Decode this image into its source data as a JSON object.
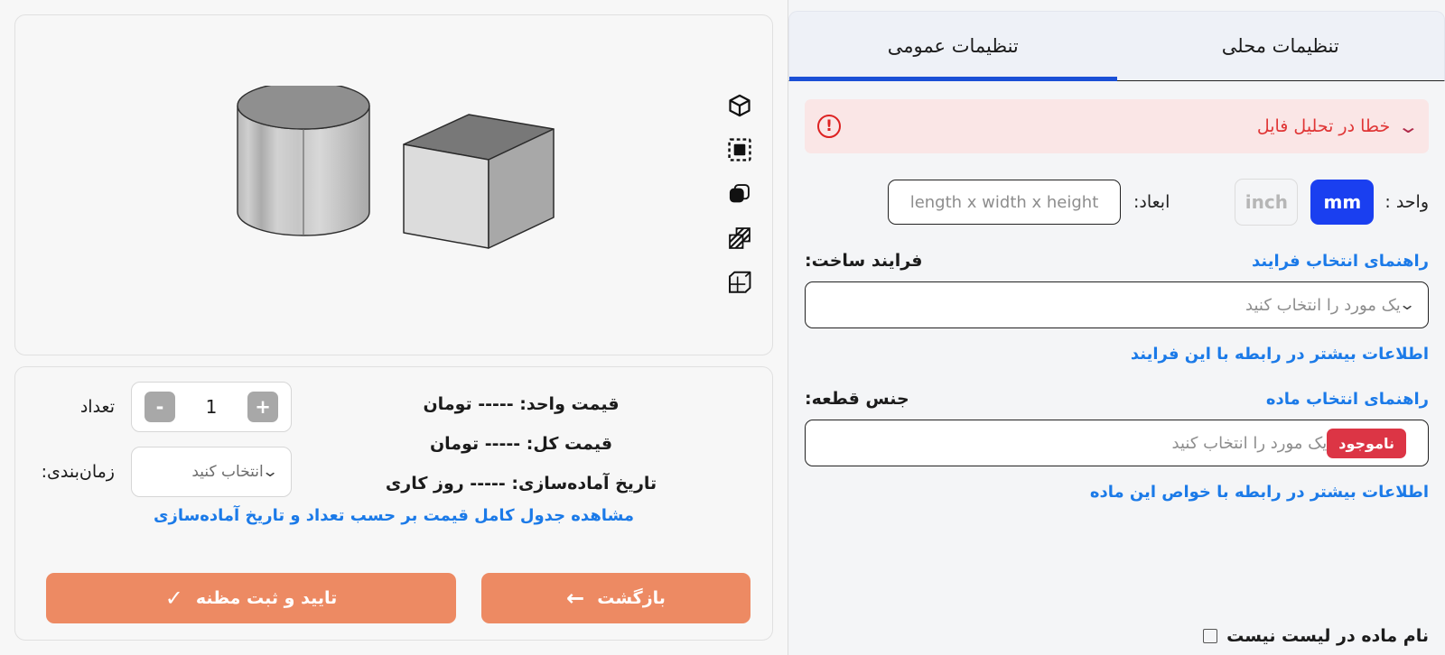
{
  "settings_panel": {
    "tabs": [
      {
        "id": "local",
        "label": "تنظیمات محلی",
        "active": false
      },
      {
        "id": "general",
        "label": "تنظیمات عمومی",
        "active": true
      }
    ],
    "error_banner": {
      "icon": "alert-circle-icon",
      "text": "خطا در تحلیل فایل",
      "expand_icon": "chevron-down-icon",
      "bg_color": "#fae6e6",
      "text_color": "#e03636"
    },
    "unit": {
      "label": "واحد :",
      "options": [
        {
          "value": "mm",
          "label": "mm",
          "selected": true
        },
        {
          "value": "inch",
          "label": "inch",
          "selected": false
        }
      ],
      "selected_color": "#1a3ff0"
    },
    "dimensions": {
      "label": "ابعاد:",
      "value": "",
      "placeholder": "length x width x height"
    },
    "process": {
      "label": "فرایند ساخت:",
      "guide_link": "راهنمای انتخاب فرایند",
      "select_placeholder": "یک مورد را انتخاب کنید",
      "select_value": "",
      "more_info_link": "اطلاعات بیشتر در رابطه با این فرایند"
    },
    "material": {
      "label": "جنس قطعه:",
      "guide_link": "راهنمای انتخاب ماده",
      "select_placeholder": "یک مورد را انتخاب کنید",
      "select_value": "",
      "badge": "ناموجود",
      "badge_color": "#dc3545",
      "more_info_link": "اطلاعات بیشتر در رابطه با خواص این ماده",
      "not_in_list_checkbox": {
        "label": "نام ماده در لیست نیست",
        "checked": false
      }
    },
    "link_color": "#1b7ae8"
  },
  "viewer": {
    "toolbar": [
      {
        "id": "cube-icon",
        "name": "3d-cube-view"
      },
      {
        "id": "bounding-box-icon",
        "name": "bounding-box-view"
      },
      {
        "id": "solid-shape-icon",
        "name": "solid-shading"
      },
      {
        "id": "hatched-section-icon",
        "name": "section-view"
      },
      {
        "id": "wireframe-cube-icon",
        "name": "wireframe-view"
      }
    ],
    "model": {
      "shapes": [
        "cylinder",
        "box"
      ],
      "background": "#f7f7f7"
    }
  },
  "pricing": {
    "unit_price": "قیمت واحد: ----- تومان",
    "total_price": "قیمت کل: ----- تومان",
    "ready_date": "تاریخ آماده‌سازی: ----- روز کاری",
    "quantity": {
      "label": "تعداد",
      "value": "1",
      "decrease_label": "-",
      "increase_label": "+"
    },
    "schedule": {
      "label": "زمان‌بندی:",
      "placeholder": "انتخاب کنید",
      "value": ""
    },
    "full_table_link": "مشاهده جدول کامل قیمت بر حسب تعداد و تاریخ آماده‌سازی",
    "actions": {
      "submit_label": "تایید و ثبت مظنه",
      "submit_icon": "check-icon",
      "back_label": "بازگشت",
      "back_icon": "arrow-left-icon",
      "button_color": "#ed8a63"
    }
  }
}
